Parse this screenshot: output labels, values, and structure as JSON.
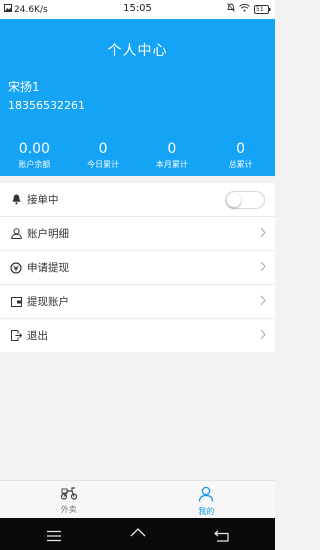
{
  "status_bar": {
    "speed": "24.6K/s",
    "time": "15:05",
    "battery": "51",
    "icons": [
      "image-icon",
      "mute-icon",
      "wifi-icon",
      "battery-icon"
    ]
  },
  "header": {
    "title": "个人中心",
    "username": "宋扬1",
    "phone": "18356532261",
    "stats": [
      {
        "value": "0.00",
        "label": "账户余额"
      },
      {
        "value": "0",
        "label": "今日累计"
      },
      {
        "value": "0",
        "label": "本月累计"
      },
      {
        "value": "0",
        "label": "总累计"
      }
    ]
  },
  "menu": [
    {
      "label": "接单中",
      "icon": "bell-icon",
      "toggle": false
    },
    {
      "label": "账户明细",
      "icon": "user-icon"
    },
    {
      "label": "申请提现",
      "icon": "withdraw-icon"
    },
    {
      "label": "提现账户",
      "icon": "wallet-icon"
    },
    {
      "label": "退出",
      "icon": "exit-icon"
    }
  ],
  "tabs": [
    {
      "label": "外卖",
      "icon": "scooter-icon",
      "active": false
    },
    {
      "label": "我的",
      "icon": "person-icon",
      "active": true
    }
  ],
  "colors": {
    "primary": "#14a3f5",
    "tab_active": "#1497e6",
    "background": "#f2f2f2"
  }
}
